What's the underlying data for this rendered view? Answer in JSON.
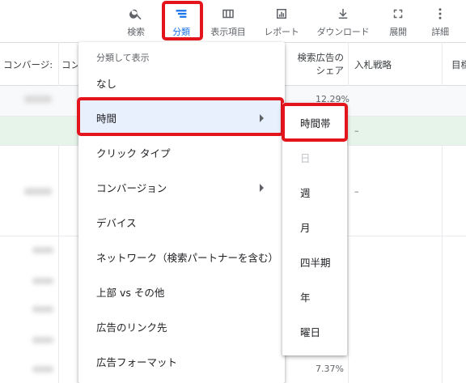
{
  "toolbar": {
    "items": [
      {
        "label": "検索",
        "icon": "search-icon"
      },
      {
        "label": "分類",
        "icon": "segment-icon",
        "active": true
      },
      {
        "label": "表示項目",
        "icon": "columns-icon"
      },
      {
        "label": "レポート",
        "icon": "reports-icon"
      },
      {
        "label": "ダウンロード",
        "icon": "download-icon"
      },
      {
        "label": "展開",
        "icon": "expand-icon"
      },
      {
        "label": "詳細",
        "icon": "more-vert-icon"
      }
    ]
  },
  "table": {
    "headers": {
      "col1": "コンバージ:",
      "col2": "コン",
      "col3": "検索広告の",
      "col3b": "シェア",
      "col4": "入札戦略",
      "col5": "目標"
    },
    "cells": {
      "r1_pct": "12.29%",
      "r2_dash": "–",
      "r3_dash": "–",
      "last_pct": "7.37%"
    }
  },
  "segment_menu": {
    "header": "分類して表示",
    "items": [
      {
        "label": "なし"
      },
      {
        "label": "時間",
        "has_submenu": true,
        "selected": true
      },
      {
        "label": "クリック タイプ"
      },
      {
        "label": "コンバージョン",
        "has_submenu": true
      },
      {
        "label": "デバイス"
      },
      {
        "label": "ネットワーク（検索パートナーを含む）"
      },
      {
        "label": "上部 vs その他"
      },
      {
        "label": "広告のリンク先"
      },
      {
        "label": "広告フォーマット"
      }
    ]
  },
  "time_submenu": {
    "items": [
      {
        "label": "時間帯"
      },
      {
        "label": "日",
        "disabled": true
      },
      {
        "label": "週"
      },
      {
        "label": "月"
      },
      {
        "label": "四半期"
      },
      {
        "label": "年"
      },
      {
        "label": "曜日"
      }
    ]
  },
  "colors": {
    "accent": "#1a73e8",
    "highlight_border": "#e3141c",
    "selected_bg": "#e8f0fe",
    "green_row": "#e6f4ea"
  }
}
